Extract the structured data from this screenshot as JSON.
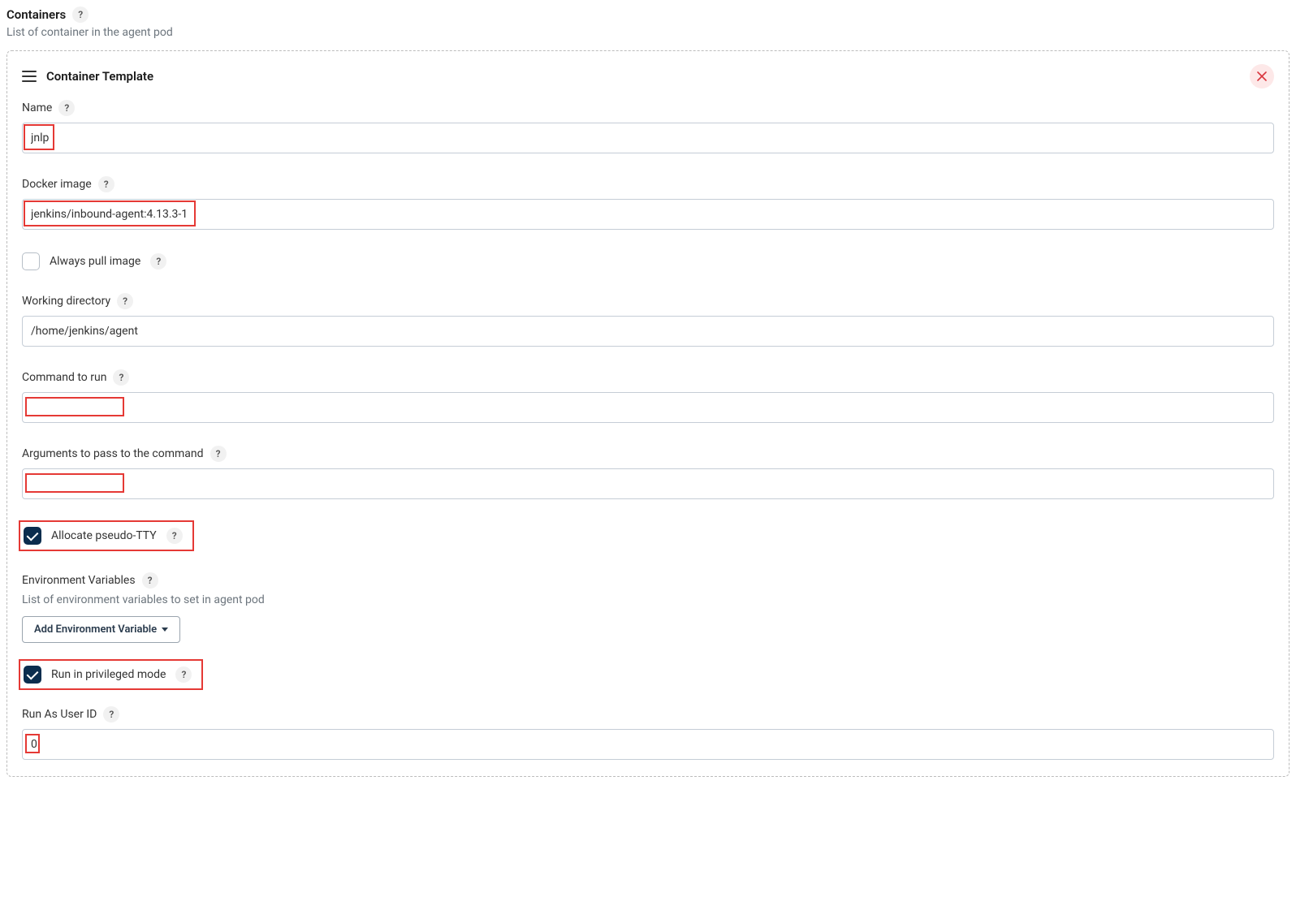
{
  "header": {
    "title": "Containers",
    "desc": "List of container in the agent pod"
  },
  "panel": {
    "title": "Container Template"
  },
  "fields": {
    "name": {
      "label": "Name",
      "value": "jnlp"
    },
    "dockerImage": {
      "label": "Docker image",
      "value": "jenkins/inbound-agent:4.13.3-1"
    },
    "alwaysPull": {
      "label": "Always pull image",
      "checked": false
    },
    "workingDir": {
      "label": "Working directory",
      "value": "/home/jenkins/agent"
    },
    "command": {
      "label": "Command to run",
      "value": ""
    },
    "arguments": {
      "label": "Arguments to pass to the command",
      "value": ""
    },
    "allocateTty": {
      "label": "Allocate pseudo-TTY",
      "checked": true
    },
    "envVars": {
      "title": "Environment Variables",
      "desc": "List of environment variables to set in agent pod",
      "addBtn": "Add Environment Variable"
    },
    "privileged": {
      "label": "Run in privileged mode",
      "checked": true
    },
    "runAsUser": {
      "label": "Run As User ID",
      "value": "0"
    }
  }
}
